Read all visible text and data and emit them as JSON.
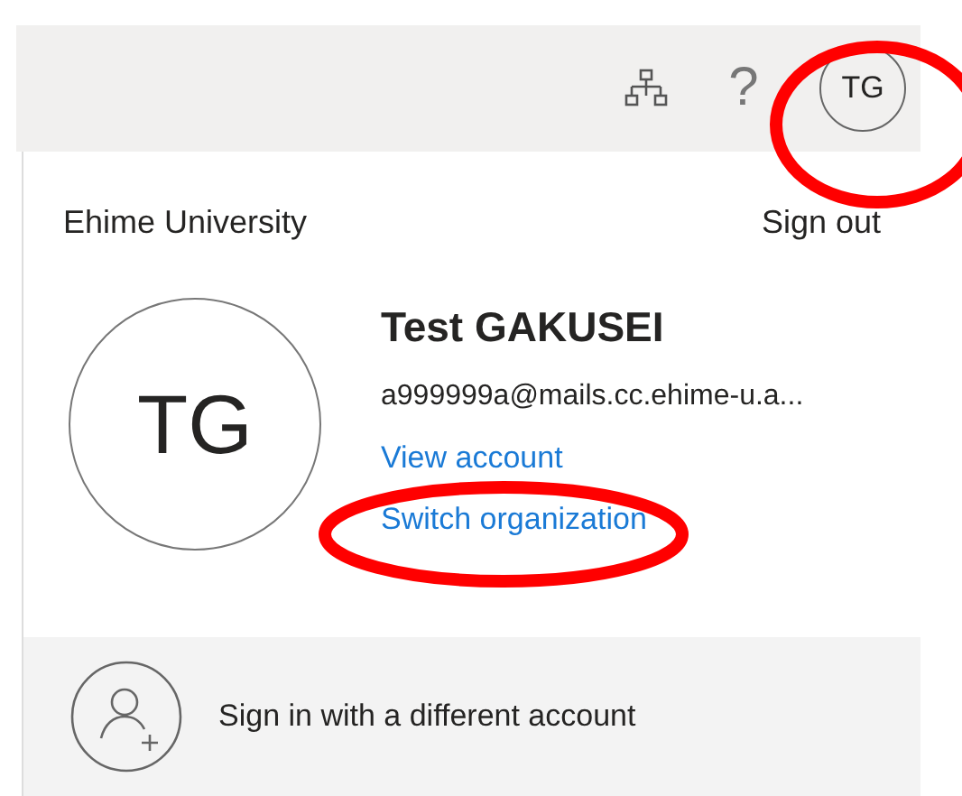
{
  "top_bar": {
    "help_label": "?",
    "avatar_initials": "TG"
  },
  "account_panel": {
    "organization": "Ehime University",
    "sign_out": "Sign out",
    "avatar_initials": "TG",
    "name": "Test GAKUSEI",
    "email": "a999999a@mails.cc.ehime-u.a...",
    "links": [
      "View account",
      "Switch organization"
    ]
  },
  "footer": {
    "label": "Sign in with a different account"
  }
}
